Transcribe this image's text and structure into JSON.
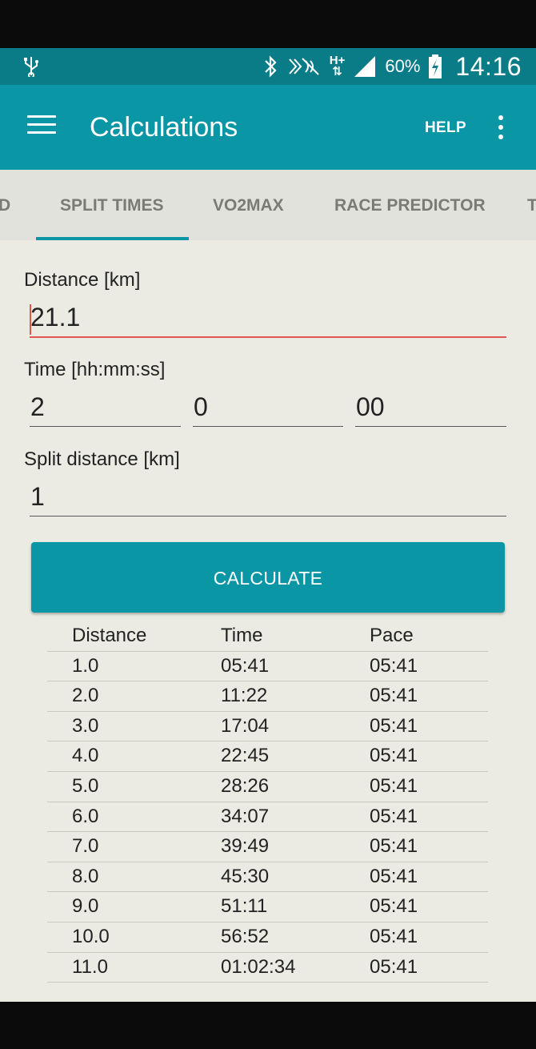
{
  "status_bar": {
    "battery": "60%",
    "time": "14:16",
    "network": "H+"
  },
  "appbar": {
    "title": "Calculations",
    "help": "HELP"
  },
  "tabs": [
    {
      "label": "D"
    },
    {
      "label": "SPLIT TIMES"
    },
    {
      "label": "VO2MAX"
    },
    {
      "label": "RACE PREDICTOR"
    },
    {
      "label": "T"
    }
  ],
  "form": {
    "distance_label": "Distance [km]",
    "distance_value": "21.1",
    "time_label": "Time [hh:mm:ss]",
    "hours": "2",
    "minutes": "0",
    "seconds": "00",
    "split_label": "Split distance [km]",
    "split_value": "1",
    "calculate": "CALCULATE"
  },
  "results": {
    "headers": [
      "Distance",
      "Time",
      "Pace"
    ],
    "rows": [
      [
        "1.0",
        "05:41",
        "05:41"
      ],
      [
        "2.0",
        "11:22",
        "05:41"
      ],
      [
        "3.0",
        "17:04",
        "05:41"
      ],
      [
        "4.0",
        "22:45",
        "05:41"
      ],
      [
        "5.0",
        "28:26",
        "05:41"
      ],
      [
        "6.0",
        "34:07",
        "05:41"
      ],
      [
        "7.0",
        "39:49",
        "05:41"
      ],
      [
        "8.0",
        "45:30",
        "05:41"
      ],
      [
        "9.0",
        "51:11",
        "05:41"
      ],
      [
        "10.0",
        "56:52",
        "05:41"
      ],
      [
        "11.0",
        "01:02:34",
        "05:41"
      ]
    ]
  },
  "colors": {
    "primary": "#0b96a6",
    "status_bar": "#0a7c88",
    "accent_caret": "#e0564f",
    "background": "#ebebe3"
  }
}
